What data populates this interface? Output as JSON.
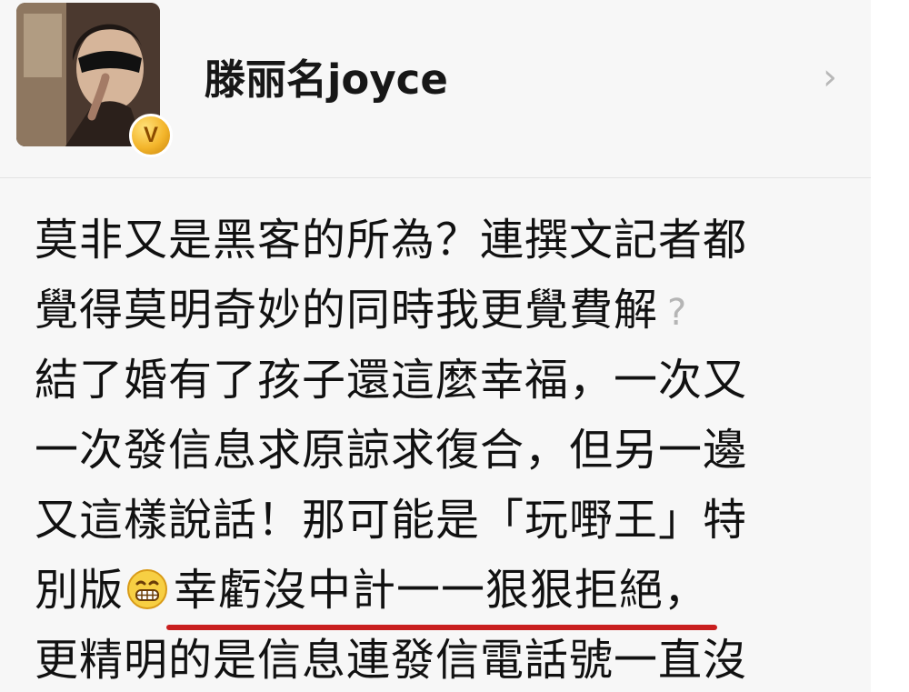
{
  "profile": {
    "username": "滕丽名joyce",
    "badge": "V",
    "chevron": "›"
  },
  "post": {
    "lines": [
      "莫非又是黑客的所為？連撰文記者都",
      "覺得莫明奇妙的同時我更覺費解",
      "結了婚有了孩子還這麼幸福，一次又",
      "一次發信息求原諒求復合，但另一邊",
      "又這樣說話！那可能是「玩嘢王」特",
      "別版",
      "幸虧沒中計一一狠狠拒絕，",
      "更精明的是信息連發信電話號一直沒"
    ],
    "question_glyph": "?"
  }
}
